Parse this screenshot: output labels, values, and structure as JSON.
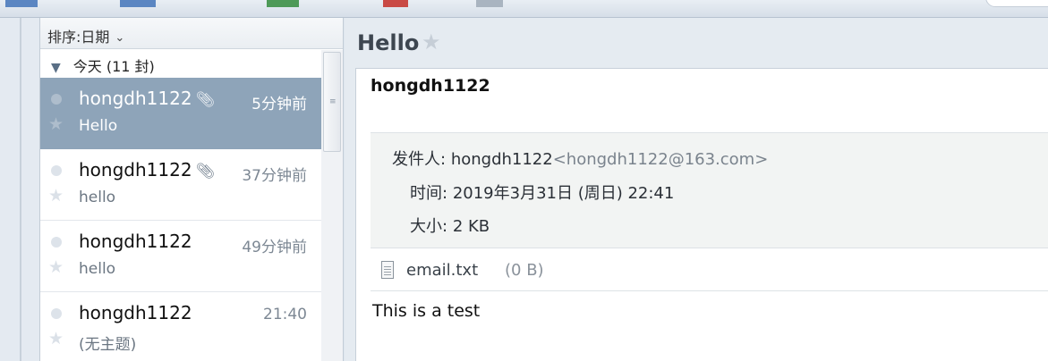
{
  "toolbar": {},
  "list": {
    "sort_label": "排序:日期",
    "group_label": "今天 (11 封)",
    "messages": [
      {
        "sender": "hongdh1122",
        "has_attachment": true,
        "time": "5分钟前",
        "subject": "Hello",
        "selected": true
      },
      {
        "sender": "hongdh1122",
        "has_attachment": true,
        "time": "37分钟前",
        "subject": "hello",
        "selected": false
      },
      {
        "sender": "hongdh1122",
        "has_attachment": false,
        "time": "49分钟前",
        "subject": "hello",
        "selected": false
      },
      {
        "sender": "hongdh1122",
        "has_attachment": false,
        "time": "21:40",
        "subject": "(无主题)",
        "selected": false
      }
    ]
  },
  "reader": {
    "title": "Hello",
    "from_name": "hongdh1122",
    "meta": {
      "from_label": "发件人:",
      "from_name": "hongdh1122",
      "from_addr": "<hongdh1122@163.com>",
      "time_label": "时间:",
      "time_value": "2019年3月31日 (周日) 22:41",
      "size_label": "大小:",
      "size_value": "2 KB"
    },
    "attachment": {
      "name": "email.txt",
      "size": "(0 B)"
    },
    "body": "This is a test"
  },
  "icons": {
    "attachment": "paperclip-icon",
    "star": "star-icon",
    "file": "file-icon",
    "sort": "chevron-down-icon",
    "group": "triangle-down-icon"
  },
  "colors": {
    "selected_row": "#8ea4b9",
    "pane_bg": "#e5ebf1"
  }
}
